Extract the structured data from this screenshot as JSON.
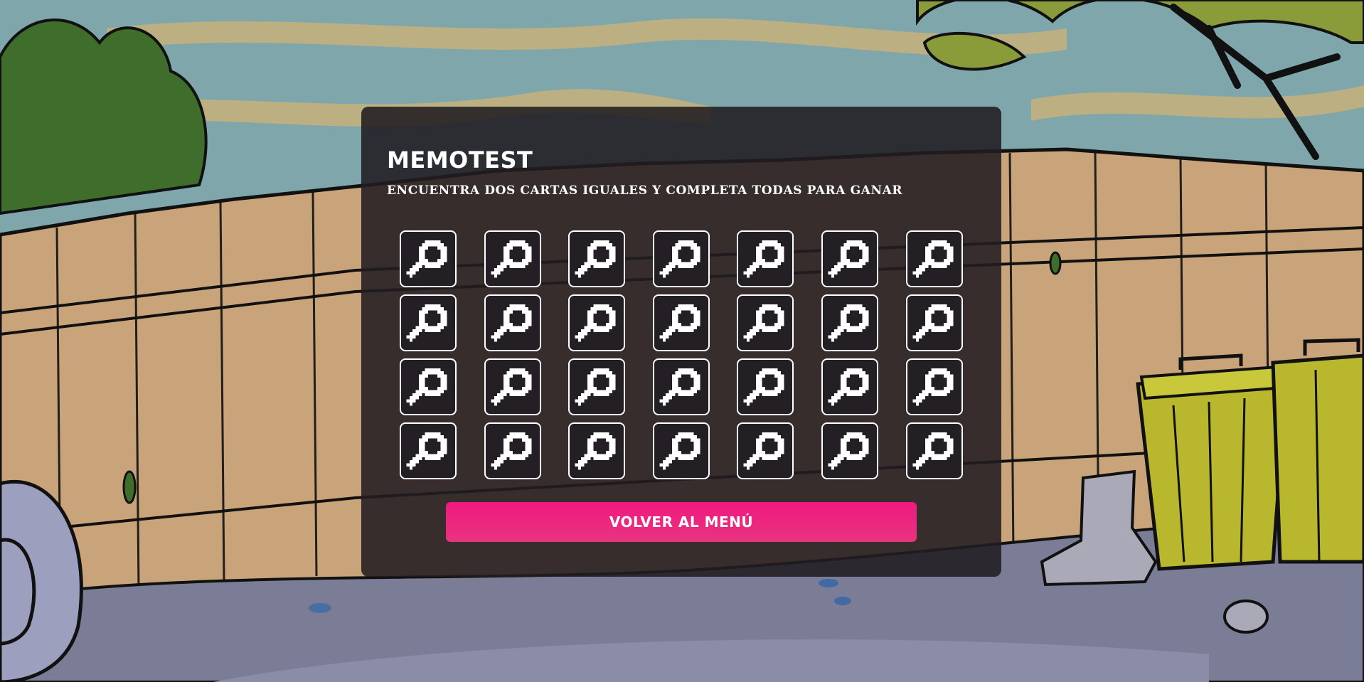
{
  "game": {
    "title": "MEMOTEST",
    "instructions": "ENCUENTRA DOS CARTAS IGUALES Y COMPLETA TODAS PARA GANAR",
    "back_button_label": "VOLVER AL MENÚ",
    "grid": {
      "columns": 7,
      "rows": 4
    },
    "card_back_icon": "magnifier-icon",
    "cards_face_down": 28
  },
  "colors": {
    "panel_background": "#211c21",
    "button_accent": "#f0197f",
    "card_border": "#ffffff",
    "sky": "#7fa7ab",
    "fence": "#c9a47a",
    "ground": "#7b7d96"
  }
}
